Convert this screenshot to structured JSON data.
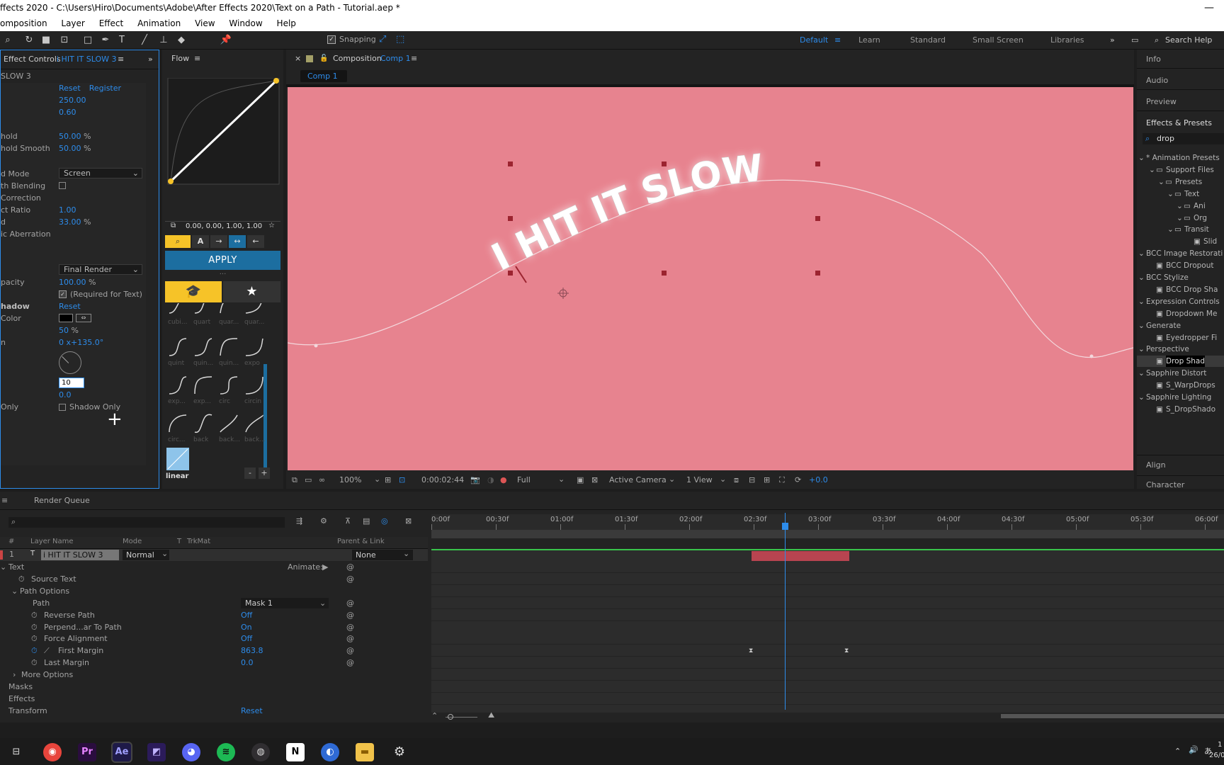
{
  "window": {
    "title": "ffects 2020 - C:\\Users\\Hiro\\Documents\\Adobe\\After Effects 2020\\Text on a Path - Tutorial.aep *",
    "minimize": "—"
  },
  "menu": [
    "omposition",
    "Layer",
    "Effect",
    "Animation",
    "View",
    "Window",
    "Help"
  ],
  "toolbar": {
    "snapping": "Snapping",
    "workspaces": [
      "Default",
      "Learn",
      "Standard",
      "Small Screen",
      "Libraries"
    ],
    "search": "Search Help"
  },
  "effect_controls": {
    "tab": "Effect Controls",
    "layer": "i HIT IT SLOW 3",
    "layer_header": "SLOW 3",
    "reset": "Reset",
    "register": "Register",
    "v1": "250.00",
    "v2": "0.60",
    "threshold_label": "hold",
    "threshold_value": "50.00",
    "threshold_smooth_label": "hold Smooth",
    "threshold_smooth_value": "50.00",
    "percent": "%",
    "mode_label": "d Mode",
    "mode_value": "Screen",
    "depth_blending": "th Blending",
    "correction": " Correction",
    "aspect_label": "ct Ratio",
    "aspect_value": "1.00",
    "spread_label": "d",
    "spread_value": "33.00",
    "aberration": "ic Aberration",
    "render_value": "Final Render",
    "opacity_label": "pacity",
    "opacity_value": "100.00",
    "required_text": "(Required for Text)",
    "shadow_label": "hadow",
    "shadow_reset": "Reset",
    "color_label": "Color",
    "shadow_opacity": "50",
    "direction_label": "n",
    "direction_value": "0 x+135.0°",
    "distance_value": "10",
    "softness_value": "0.0",
    "only_label": "Only",
    "shadow_only": "Shadow Only"
  },
  "flow": {
    "tab": "Flow",
    "values": "0.00, 0.00, 1.00, 1.00",
    "apply": "APPLY",
    "more": "...",
    "ease_labels": [
      "cubi...",
      "quart",
      "quar...",
      "quar...",
      "quint",
      "quin...",
      "quin...",
      "expo",
      "exp...",
      "exp...",
      "circ",
      "circin",
      "circ...",
      "back",
      "back...",
      "back..."
    ],
    "selected": "linear",
    "minus": "-",
    "plus": "+"
  },
  "composition": {
    "tab_prefix": "Composition",
    "name": "Comp 1",
    "chip": "Comp 1",
    "canvas_text": "I HIT IT SLOW",
    "zoom": "100%",
    "timecode": "0:00:02:44",
    "resolution": "Full",
    "camera": "Active Camera",
    "views": "1 View",
    "exposure": "+0.0"
  },
  "right_panels": {
    "info": "Info",
    "audio": "Audio",
    "preview": "Preview",
    "effects_presets": "Effects & Presets",
    "search_value": "drop",
    "tree": [
      "* Animation Presets",
      "Support Files",
      "Presets",
      "Text",
      "Ani",
      "Org",
      "Transit",
      "Slid",
      "BCC Image Restorati",
      "BCC Dropout",
      "BCC Stylize",
      "BCC Drop Sha",
      "Expression Controls",
      "Dropdown Me",
      "Generate",
      "Eyedropper Fi",
      "Perspective",
      "Drop Shad",
      "Sapphire Distort",
      "S_WarpDrops",
      "Sapphire Lighting",
      "S_DropShado"
    ],
    "align": "Align",
    "character": "Character"
  },
  "timeline": {
    "render_queue": "Render Queue",
    "col_num": "#",
    "col_layer": "Layer Name",
    "col_mode": "Mode",
    "col_t": "T",
    "col_trkmat": "TrkMat",
    "col_parent": "Parent & Link",
    "layer_num": "1",
    "layer_name": "i HIT IT SLOW 3",
    "layer_mode": "Normal",
    "layer_parent": "None",
    "animate": "Animate:",
    "text": "Text",
    "source_text": "Source Text",
    "path_options": "Path Options",
    "path": "Path",
    "path_value": "Mask 1",
    "reverse_path": "Reverse Path",
    "reverse_value": "Off",
    "perpendicular": "Perpend...ar To Path",
    "perpendicular_value": "On",
    "force_alignment": "Force Alignment",
    "force_value": "Off",
    "first_margin": "First Margin",
    "first_margin_value": "863.8",
    "last_margin": "Last Margin",
    "last_margin_value": "0.0",
    "more_options": "More Options",
    "masks": "Masks",
    "effects": "Effects",
    "transform": "Transform",
    "transform_reset": "Reset",
    "ruler": [
      "0:00f",
      "00:30f",
      "01:00f",
      "01:30f",
      "02:00f",
      "02:30f",
      "03:00f",
      "03:30f",
      "04:00f",
      "04:30f",
      "05:00f",
      "05:30f",
      "06:00f"
    ]
  },
  "taskbar": {
    "apps": [
      "chrome",
      "premiere",
      "after-effects",
      "media-encoder",
      "discord",
      "spotify",
      "obs",
      "notion",
      "files-app",
      "explorer",
      "settings"
    ],
    "time": "1",
    "date": "26/0"
  }
}
